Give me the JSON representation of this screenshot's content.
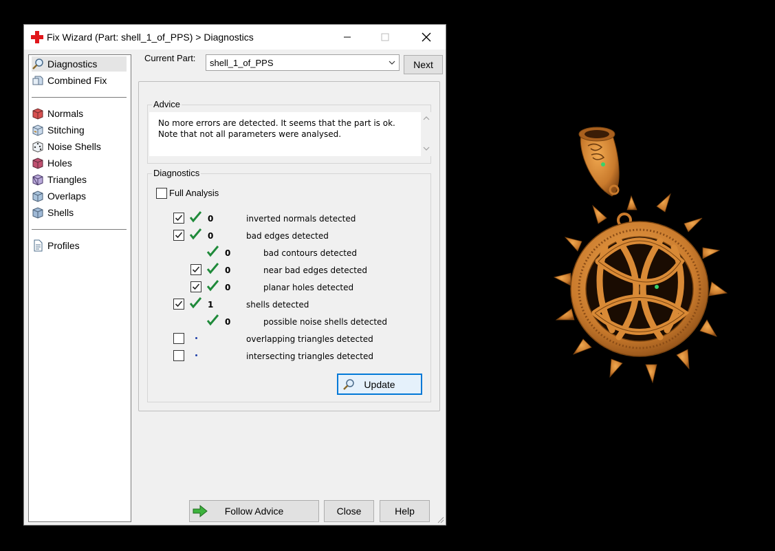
{
  "window": {
    "title": "Fix Wizard (Part: shell_1_of_PPS) > Diagnostics",
    "controls": [
      "minimize",
      "maximize",
      "close"
    ]
  },
  "sidebar": {
    "items": [
      {
        "label": "Diagnostics",
        "icon": "magnifier-icon",
        "selected": true
      },
      {
        "label": "Combined Fix",
        "icon": "cube-stack-icon"
      },
      {
        "label": "Normals",
        "icon": "cube-red-icon"
      },
      {
        "label": "Stitching",
        "icon": "cube-stitch-icon"
      },
      {
        "label": "Noise Shells",
        "icon": "dice-icon"
      },
      {
        "label": "Holes",
        "icon": "cube-hole-icon"
      },
      {
        "label": "Triangles",
        "icon": "cube-triangles-icon"
      },
      {
        "label": "Overlaps",
        "icon": "cube-overlap-icon"
      },
      {
        "label": "Shells",
        "icon": "cube-shells-icon"
      },
      {
        "label": "Profiles",
        "icon": "document-icon"
      }
    ]
  },
  "part": {
    "label": "Current Part:",
    "value": "shell_1_of_PPS"
  },
  "next_label": "Next",
  "advice": {
    "title": "Advice",
    "text": "No more errors are detected. It seems that the part is ok. Note that not all parameters were analysed."
  },
  "diagnostics": {
    "title": "Diagnostics",
    "full_analysis_label": "Full Analysis",
    "full_analysis_checked": false,
    "rows": [
      {
        "checkbox": true,
        "checked": true,
        "status": "ok",
        "count": "0",
        "label": "inverted normals detected",
        "indent": 0
      },
      {
        "checkbox": true,
        "checked": true,
        "status": "ok",
        "count": "0",
        "label": "bad edges detected",
        "indent": 0
      },
      {
        "checkbox": false,
        "checked": false,
        "status": "ok",
        "count": "0",
        "label": "bad contours detected",
        "indent": 1
      },
      {
        "checkbox": true,
        "checked": true,
        "status": "ok",
        "count": "0",
        "label": "near bad edges detected",
        "indent": 1
      },
      {
        "checkbox": true,
        "checked": true,
        "status": "ok",
        "count": "0",
        "label": "planar holes detected",
        "indent": 1
      },
      {
        "checkbox": true,
        "checked": true,
        "status": "ok",
        "count": "1",
        "label": "shells detected",
        "indent": 0
      },
      {
        "checkbox": false,
        "checked": false,
        "status": "ok",
        "count": "0",
        "label": "possible noise shells detected",
        "indent": 1
      },
      {
        "checkbox": true,
        "checked": false,
        "status": "unknown",
        "count": "",
        "label": "overlapping triangles detected",
        "indent": 0
      },
      {
        "checkbox": true,
        "checked": false,
        "status": "unknown",
        "count": "",
        "label": "intersecting triangles detected",
        "indent": 0
      }
    ],
    "update_label": "Update"
  },
  "footer": {
    "follow_advice_label": "Follow Advice",
    "close_label": "Close",
    "help_label": "Help"
  },
  "colors": {
    "accent": "#0078d7",
    "tick": "#1f8a3a",
    "model": "#c97a2c",
    "marker": "#38d46a"
  }
}
